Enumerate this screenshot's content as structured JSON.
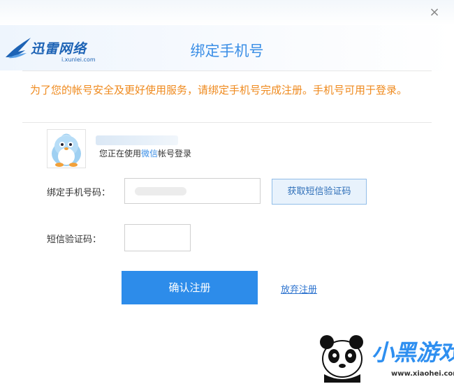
{
  "window": {
    "close_glyph": "×",
    "logo_text": "迅雷网络",
    "logo_url": "i.xunlei.com",
    "title": "绑定手机号"
  },
  "notice": {
    "text": "为了您的帐号安全及更好使用服务，请绑定手机号完成注册。手机号可用于登录。"
  },
  "account": {
    "login_prefix": "您正在使用",
    "login_provider": "微信",
    "login_suffix": "帐号登录"
  },
  "form": {
    "phone_label": "绑定手机号码：",
    "sms_button": "获取短信验证码",
    "code_label": "短信验证码：",
    "confirm_button": "确认注册",
    "abandon_link": "放弃注册"
  },
  "watermark": {
    "title": "小黑游戏",
    "url": "www.xiaohei.com"
  },
  "colors": {
    "title_blue": "#3a8ee6",
    "notice_orange": "#ef8a1e",
    "primary_button": "#2d8cea",
    "link_blue": "#2e74cf"
  }
}
